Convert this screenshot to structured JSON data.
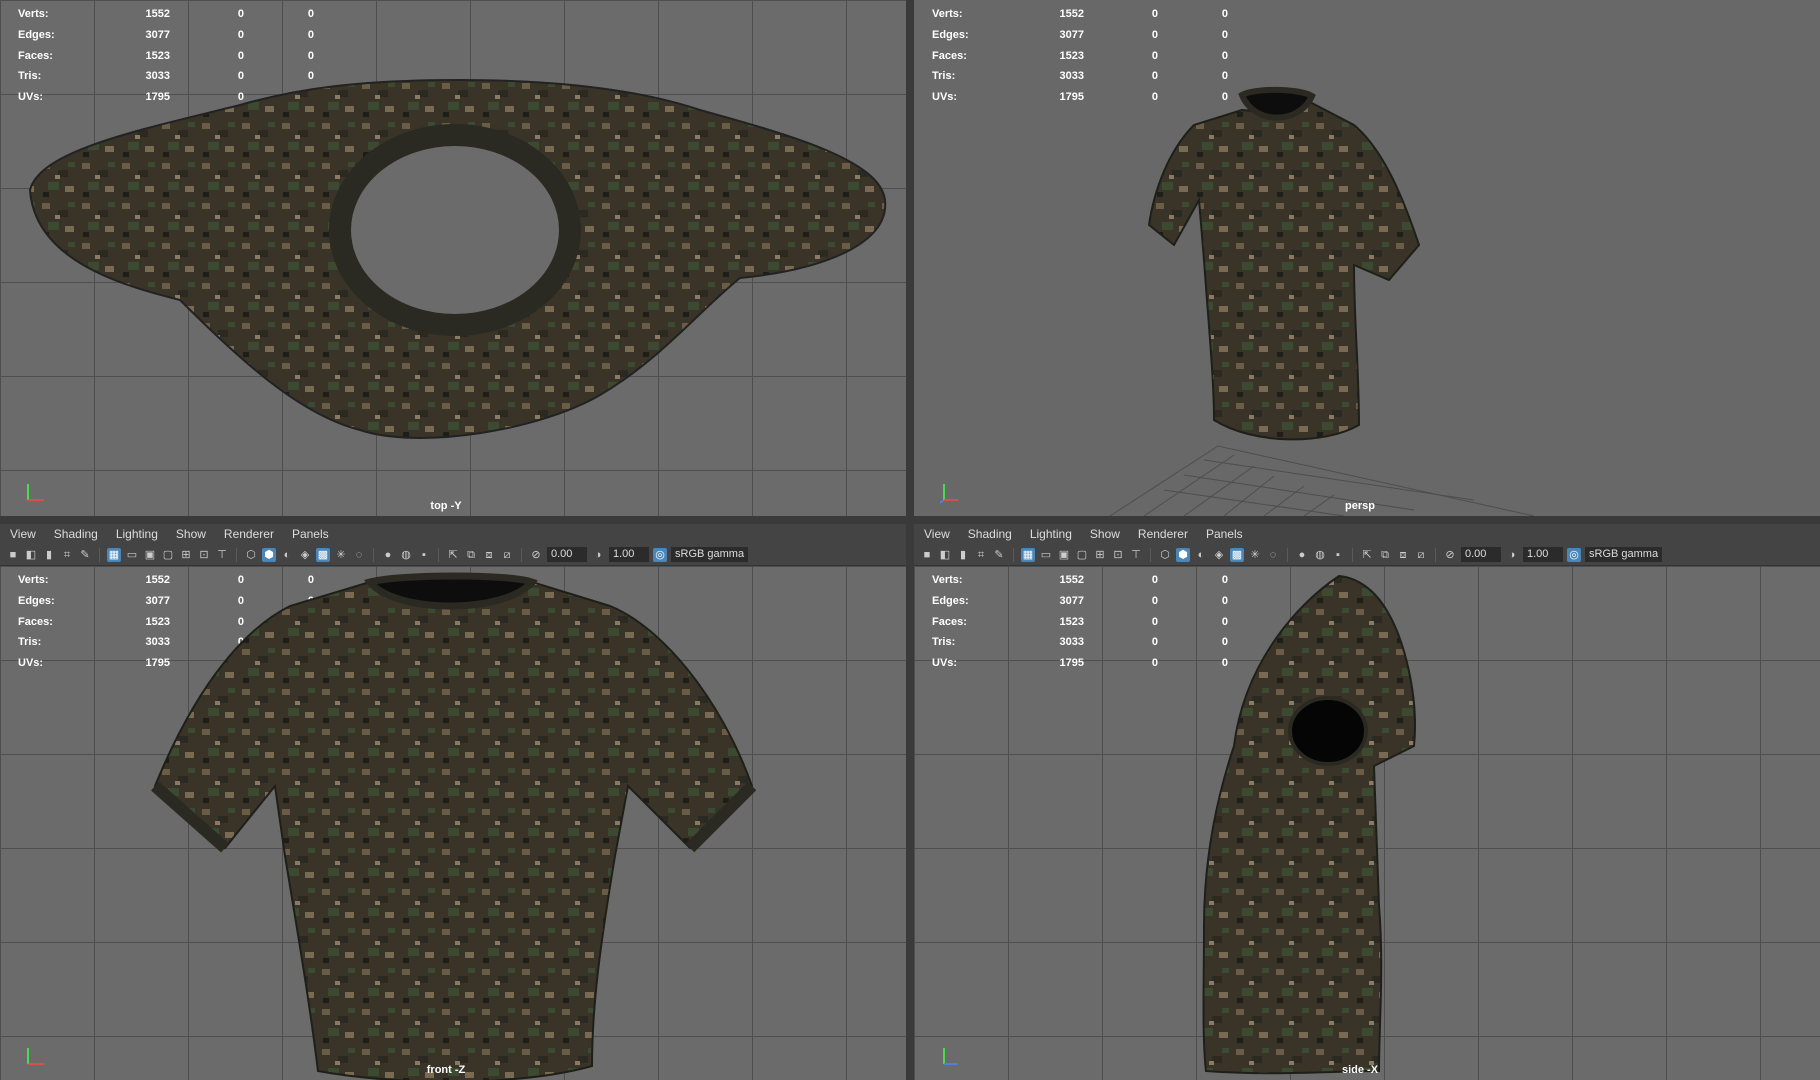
{
  "stats": [
    {
      "label": "Verts:",
      "v1": "1552",
      "v2": "0",
      "v3": "0"
    },
    {
      "label": "Edges:",
      "v1": "3077",
      "v2": "0",
      "v3": "0"
    },
    {
      "label": "Faces:",
      "v1": "1523",
      "v2": "0",
      "v3": "0"
    },
    {
      "label": "Tris:",
      "v1": "3033",
      "v2": "0",
      "v3": "0"
    },
    {
      "label": "UVs:",
      "v1": "1795",
      "v2": "0",
      "v3": "0"
    }
  ],
  "viewports": {
    "top": {
      "camera": "top -Y"
    },
    "persp": {
      "camera": "persp"
    },
    "front": {
      "camera": "front -Z"
    },
    "side": {
      "camera": "side -X"
    }
  },
  "menu": [
    "View",
    "Shading",
    "Lighting",
    "Show",
    "Renderer",
    "Panels"
  ],
  "toolbar": {
    "exposure": "0.00",
    "gamma": "1.00",
    "colorspace": "sRGB gamma"
  },
  "colors": {
    "grid": "#4e4e4e",
    "viewport": "#6b6b6b",
    "camo_dark": "#2d2a22",
    "camo_tan": "#6b5c45",
    "camo_green": "#3c4a32"
  }
}
